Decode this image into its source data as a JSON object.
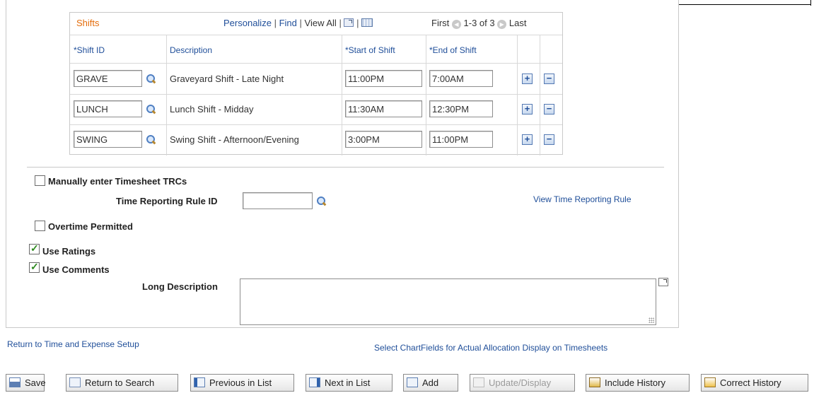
{
  "grid": {
    "title": "Shifts",
    "nav": {
      "personalize": "Personalize",
      "sep1": "|",
      "find": "Find",
      "sep2": "|",
      "view_all": "View All",
      "sep3": "|",
      "sep4": "|"
    },
    "pager": {
      "first": "First",
      "range": "1-3 of 3",
      "last": "Last"
    },
    "columns": {
      "shift_id": "*Shift ID",
      "description": "Description",
      "start": "*Start of Shift",
      "end": "*End of Shift"
    },
    "rows": [
      {
        "shift_id": "GRAVE",
        "description": "Graveyard Shift - Late Night",
        "start": "11:00PM",
        "end": "7:00AM"
      },
      {
        "shift_id": "LUNCH",
        "description": "Lunch Shift - Midday",
        "start": "11:30AM",
        "end": "12:30PM"
      },
      {
        "shift_id": "SWING",
        "description": "Swing Shift - Afternoon/Evening",
        "start": "3:00PM",
        "end": "11:00PM"
      }
    ],
    "add_symbol": "+",
    "remove_symbol": "−"
  },
  "form": {
    "manual_trc_label": "Manually enter Timesheet TRCs",
    "manual_trc_checked": false,
    "trr_label": "Time Reporting Rule ID",
    "trr_value": "",
    "view_trr_link": "View Time Reporting Rule",
    "overtime_label": "Overtime Permitted",
    "overtime_checked": false,
    "use_ratings_label": "Use Ratings",
    "use_ratings_checked": true,
    "use_comments_label": "Use Comments",
    "use_comments_checked": true,
    "long_desc_label": "Long Description",
    "long_desc_value": ""
  },
  "links": {
    "return_setup": "Return to Time and Expense Setup",
    "chartfields": "Select ChartFields for Actual Allocation Display on Timesheets"
  },
  "toolbar": {
    "save": "Save",
    "return_search": "Return to Search",
    "previous": "Previous in List",
    "next": "Next in List",
    "add": "Add",
    "update_display": "Update/Display",
    "include_history": "Include History",
    "correct_history": "Correct History"
  },
  "colors": {
    "accent_orange": "#e46c0a",
    "link_blue": "#1f4e99",
    "check_green": "#2d8a1e"
  }
}
